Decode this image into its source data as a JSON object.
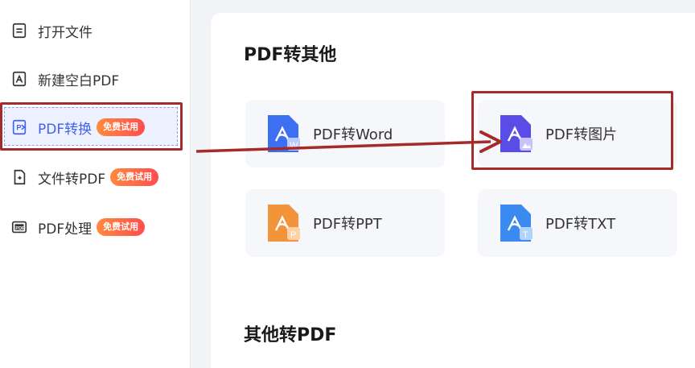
{
  "sidebar": {
    "items": [
      {
        "label": "打开文件",
        "icon": "document-icon"
      },
      {
        "label": "新建空白PDF",
        "icon": "pdf-icon"
      },
      {
        "label": "PDF转换",
        "icon": "pdf-convert-icon",
        "badge": "免费试用",
        "active": true
      },
      {
        "label": "文件转PDF",
        "icon": "file-to-pdf-icon",
        "badge": "免费试用"
      },
      {
        "label": "PDF处理",
        "icon": "pdf-process-icon",
        "badge": "免费试用"
      }
    ]
  },
  "main": {
    "sections": [
      {
        "title": "PDF转其他",
        "cards": [
          {
            "label": "PDF转Word",
            "icon": "pdf-to-word-icon",
            "color": "#3d6ff2"
          },
          {
            "label": "PDF转图片",
            "icon": "pdf-to-image-icon",
            "color": "#5a4de6"
          },
          {
            "label": "PDF转PPT",
            "icon": "pdf-to-ppt-icon",
            "color": "#f4943a"
          },
          {
            "label": "PDF转TXT",
            "icon": "pdf-to-txt-icon",
            "color": "#3a8af0"
          }
        ]
      },
      {
        "title": "其他转PDF"
      }
    ]
  },
  "colors": {
    "accent": "#3f62f0",
    "annotation": "#a52a2a",
    "badge_start": "#ff8a3d",
    "badge_end": "#ff4d4f"
  }
}
